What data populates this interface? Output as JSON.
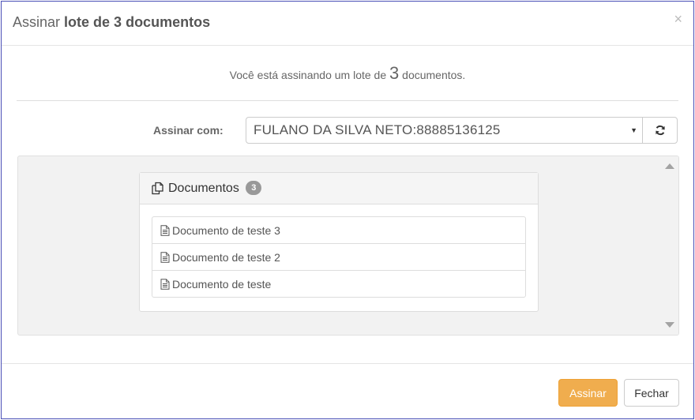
{
  "header": {
    "title_prefix": "Assinar",
    "title_bold": "lote de 3 documentos",
    "close_label": "×"
  },
  "intro": {
    "before": "Você está assinando um lote de",
    "count": "3",
    "after": "documentos."
  },
  "signer": {
    "label": "Assinar com:",
    "selected": "FULANO DA SILVA NETO:88885136125",
    "arrow": "▼"
  },
  "documents": {
    "title": "Documentos",
    "badge": "3",
    "items": [
      {
        "label": "Documento de teste 3"
      },
      {
        "label": "Documento de teste 2"
      },
      {
        "label": "Documento de teste"
      }
    ]
  },
  "footer": {
    "sign_label": "Assinar",
    "close_label": "Fechar"
  },
  "colors": {
    "primary": "#f0ad4e",
    "modal_border": "#4a4fb6",
    "badge": "#999999"
  },
  "icons": {
    "refresh": "refresh-icon",
    "panel": "copy-documents-icon",
    "item": "file-text-icon"
  }
}
